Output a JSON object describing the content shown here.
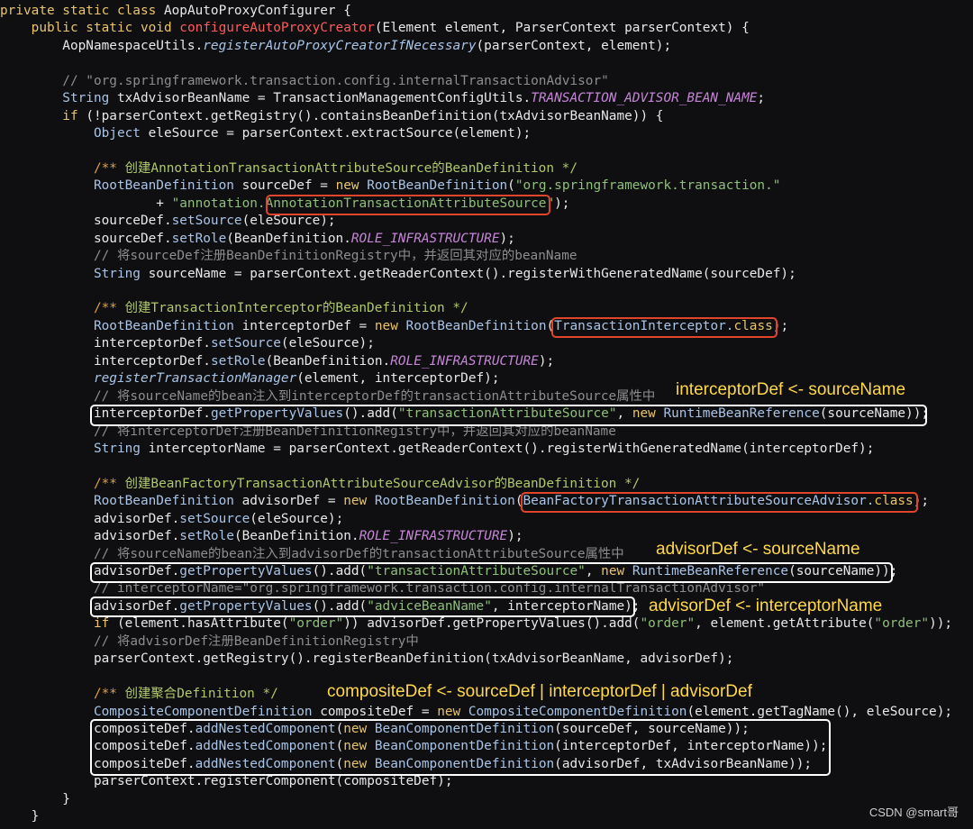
{
  "code_lines": [
    [
      [
        "kw",
        "private static class "
      ],
      [
        "t",
        "AopAutoProxyConfigurer {"
      ]
    ],
    [
      [
        "kw",
        "    public static void "
      ],
      [
        "fnr",
        "configureAutoProxyCreator"
      ],
      [
        "t",
        "(Element element, ParserContext parserContext) {"
      ]
    ],
    [
      [
        "t",
        "        AopNamespaceUtils."
      ],
      [
        "it",
        "registerAutoProxyCreatorIfNecessary"
      ],
      [
        "t",
        "(parserContext, element);"
      ]
    ],
    [],
    [
      [
        "c",
        "        // \"org.springframework.transaction.config.internalTransactionAdvisor\""
      ]
    ],
    [
      [
        "cl",
        "        String "
      ],
      [
        "t",
        "txAdvisorBeanName = TransactionManagementConfigUtils."
      ],
      [
        "cst",
        "TRANSACTION_ADVISOR_BEAN_NAME"
      ],
      [
        "t",
        ";"
      ]
    ],
    [
      [
        "kw",
        "        if "
      ],
      [
        "t",
        "(!parserContext.getRegistry().containsBeanDefinition(txAdvisorBeanName)) {"
      ]
    ],
    [
      [
        "cl",
        "            Object "
      ],
      [
        "t",
        "eleSource = parserContext.extractSource(element);"
      ]
    ],
    [],
    [
      [
        "dk",
        "            /** "
      ],
      [
        "gr",
        "创建AnnotationTransactionAttributeSource的BeanDefinition */"
      ]
    ],
    [
      [
        "cl",
        "            RootBeanDefinition "
      ],
      [
        "t",
        "sourceDef = "
      ],
      [
        "kw",
        "new "
      ],
      [
        "fn",
        "RootBeanDefinition"
      ],
      [
        "t",
        "("
      ],
      [
        "s",
        "\"org.springframework.transaction.\""
      ]
    ],
    [
      [
        "t",
        "                    + "
      ],
      [
        "s",
        "\"annotation.AnnotationTransactionAttributeSource\""
      ],
      [
        "t",
        ");"
      ]
    ],
    [
      [
        "t",
        "            sourceDef."
      ],
      [
        "fn",
        "setSource"
      ],
      [
        "t",
        "(eleSource);"
      ]
    ],
    [
      [
        "t",
        "            sourceDef."
      ],
      [
        "fn",
        "setRole"
      ],
      [
        "t",
        "(BeanDefinition."
      ],
      [
        "cst",
        "ROLE_INFRASTRUCTURE"
      ],
      [
        "t",
        ");"
      ]
    ],
    [
      [
        "c",
        "            // 将sourceDef注册BeanDefinitionRegistry中，并返回其对应的beanName"
      ]
    ],
    [
      [
        "cl",
        "            String "
      ],
      [
        "t",
        "sourceName = parserContext.getReaderContext().registerWithGeneratedName(sourceDef);"
      ]
    ],
    [],
    [
      [
        "dk",
        "            /** "
      ],
      [
        "gr",
        "创建TransactionInterceptor的BeanDefinition */"
      ]
    ],
    [
      [
        "cl",
        "            RootBeanDefinition "
      ],
      [
        "t",
        "interceptorDef = "
      ],
      [
        "kw",
        "new "
      ],
      [
        "fn",
        "RootBeanDefinition"
      ],
      [
        "t",
        "("
      ],
      [
        "fn",
        "TransactionInterceptor."
      ],
      [
        "kw",
        "class"
      ],
      [
        "t",
        ");"
      ]
    ],
    [
      [
        "t",
        "            interceptorDef."
      ],
      [
        "fn",
        "setSource"
      ],
      [
        "t",
        "(eleSource);"
      ]
    ],
    [
      [
        "t",
        "            interceptorDef."
      ],
      [
        "fn",
        "setRole"
      ],
      [
        "t",
        "(BeanDefinition."
      ],
      [
        "cst",
        "ROLE_INFRASTRUCTURE"
      ],
      [
        "t",
        ");"
      ]
    ],
    [
      [
        "it",
        "            registerTransactionManager"
      ],
      [
        "t",
        "(element, interceptorDef);"
      ]
    ],
    [
      [
        "c",
        "            // 将sourceName的bean注入到interceptorDef的transactionAttributeSource属性中"
      ]
    ],
    [
      [
        "t",
        "            interceptorDef."
      ],
      [
        "fn",
        "getPropertyValues"
      ],
      [
        "t",
        "().add("
      ],
      [
        "s",
        "\"transactionAttributeSource\""
      ],
      [
        "t",
        ", "
      ],
      [
        "kw",
        "new "
      ],
      [
        "fn",
        "RuntimeBeanReference"
      ],
      [
        "t",
        "(sourceName));"
      ]
    ],
    [
      [
        "c",
        "            // 将interceptorDef注册BeanDefinitionRegistry中，并返回其对应的beanName"
      ]
    ],
    [
      [
        "cl",
        "            String "
      ],
      [
        "t",
        "interceptorName = parserContext.getReaderContext().registerWithGeneratedName(interceptorDef);"
      ]
    ],
    [],
    [
      [
        "dk",
        "            /** "
      ],
      [
        "gr",
        "创建BeanFactoryTransactionAttributeSourceAdvisor的BeanDefinition */"
      ]
    ],
    [
      [
        "cl",
        "            RootBeanDefinition "
      ],
      [
        "t",
        "advisorDef = "
      ],
      [
        "kw",
        "new "
      ],
      [
        "fn",
        "RootBeanDefinition"
      ],
      [
        "t",
        "("
      ],
      [
        "fn",
        "BeanFactoryTransactionAttributeSourceAdvisor."
      ],
      [
        "kw",
        "class"
      ],
      [
        "t",
        ");"
      ]
    ],
    [
      [
        "t",
        "            advisorDef."
      ],
      [
        "fn",
        "setSource"
      ],
      [
        "t",
        "(eleSource);"
      ]
    ],
    [
      [
        "t",
        "            advisorDef."
      ],
      [
        "fn",
        "setRole"
      ],
      [
        "t",
        "(BeanDefinition."
      ],
      [
        "cst",
        "ROLE_INFRASTRUCTURE"
      ],
      [
        "t",
        ");"
      ]
    ],
    [
      [
        "c",
        "            // 将sourceName的bean注入到advisorDef的transactionAttributeSource属性中"
      ]
    ],
    [
      [
        "t",
        "            advisorDef."
      ],
      [
        "fn",
        "getPropertyValues"
      ],
      [
        "t",
        "().add("
      ],
      [
        "s",
        "\"transactionAttributeSource\""
      ],
      [
        "t",
        ", "
      ],
      [
        "kw",
        "new "
      ],
      [
        "fn",
        "RuntimeBeanReference"
      ],
      [
        "t",
        "(sourceName));"
      ]
    ],
    [
      [
        "c",
        "            // interceptorName=\"org.springframework.transaction.config.internalTransactionAdvisor\""
      ]
    ],
    [
      [
        "t",
        "            advisorDef."
      ],
      [
        "fn",
        "getPropertyValues"
      ],
      [
        "t",
        "().add("
      ],
      [
        "s",
        "\"adviceBeanName\""
      ],
      [
        "t",
        ", interceptorName);"
      ]
    ],
    [
      [
        "kw",
        "            if "
      ],
      [
        "t",
        "(element.hasAttribute("
      ],
      [
        "s",
        "\"order\""
      ],
      [
        "t",
        ")) advisorDef.getPropertyValues().add("
      ],
      [
        "s",
        "\"order\""
      ],
      [
        "t",
        ", element.getAttribute("
      ],
      [
        "s",
        "\"order\""
      ],
      [
        "t",
        "));"
      ]
    ],
    [
      [
        "c",
        "            // 将advisorDef注册BeanDefinitionRegistry中"
      ]
    ],
    [
      [
        "t",
        "            parserContext.getRegistry().registerBeanDefinition(txAdvisorBeanName, advisorDef);"
      ]
    ],
    [],
    [
      [
        "dk",
        "            /** "
      ],
      [
        "gr",
        "创建聚合Definition */"
      ]
    ],
    [
      [
        "cl",
        "            CompositeComponentDefinition "
      ],
      [
        "t",
        "compositeDef = "
      ],
      [
        "kw",
        "new "
      ],
      [
        "fn",
        "CompositeComponentDefinition"
      ],
      [
        "t",
        "(element.getTagName(), eleSource);"
      ]
    ],
    [
      [
        "t",
        "            compositeDef."
      ],
      [
        "fn",
        "addNestedComponent"
      ],
      [
        "t",
        "("
      ],
      [
        "kw",
        "new "
      ],
      [
        "fn",
        "BeanComponentDefinition"
      ],
      [
        "t",
        "(sourceDef, sourceName));"
      ]
    ],
    [
      [
        "t",
        "            compositeDef."
      ],
      [
        "fn",
        "addNestedComponent"
      ],
      [
        "t",
        "("
      ],
      [
        "kw",
        "new "
      ],
      [
        "fn",
        "BeanComponentDefinition"
      ],
      [
        "t",
        "(interceptorDef, interceptorName));"
      ]
    ],
    [
      [
        "t",
        "            compositeDef."
      ],
      [
        "fn",
        "addNestedComponent"
      ],
      [
        "t",
        "("
      ],
      [
        "kw",
        "new "
      ],
      [
        "fn",
        "BeanComponentDefinition"
      ],
      [
        "t",
        "(advisorDef, txAdvisorBeanName));"
      ]
    ],
    [
      [
        "t",
        "            parserContext.registerComponent(compositeDef);"
      ]
    ],
    [
      [
        "t",
        "        }"
      ]
    ],
    [
      [
        "t",
        "    }"
      ]
    ]
  ],
  "annotations": {
    "interceptor_note": "interceptorDef <- sourceName",
    "advisor_source_note": "advisorDef <- sourceName",
    "advisor_interceptor_note": "advisorDef <- interceptorName",
    "composite_note": "compositeDef <- sourceDef | interceptorDef | advisorDef"
  },
  "watermark": "CSDN @smart哥"
}
